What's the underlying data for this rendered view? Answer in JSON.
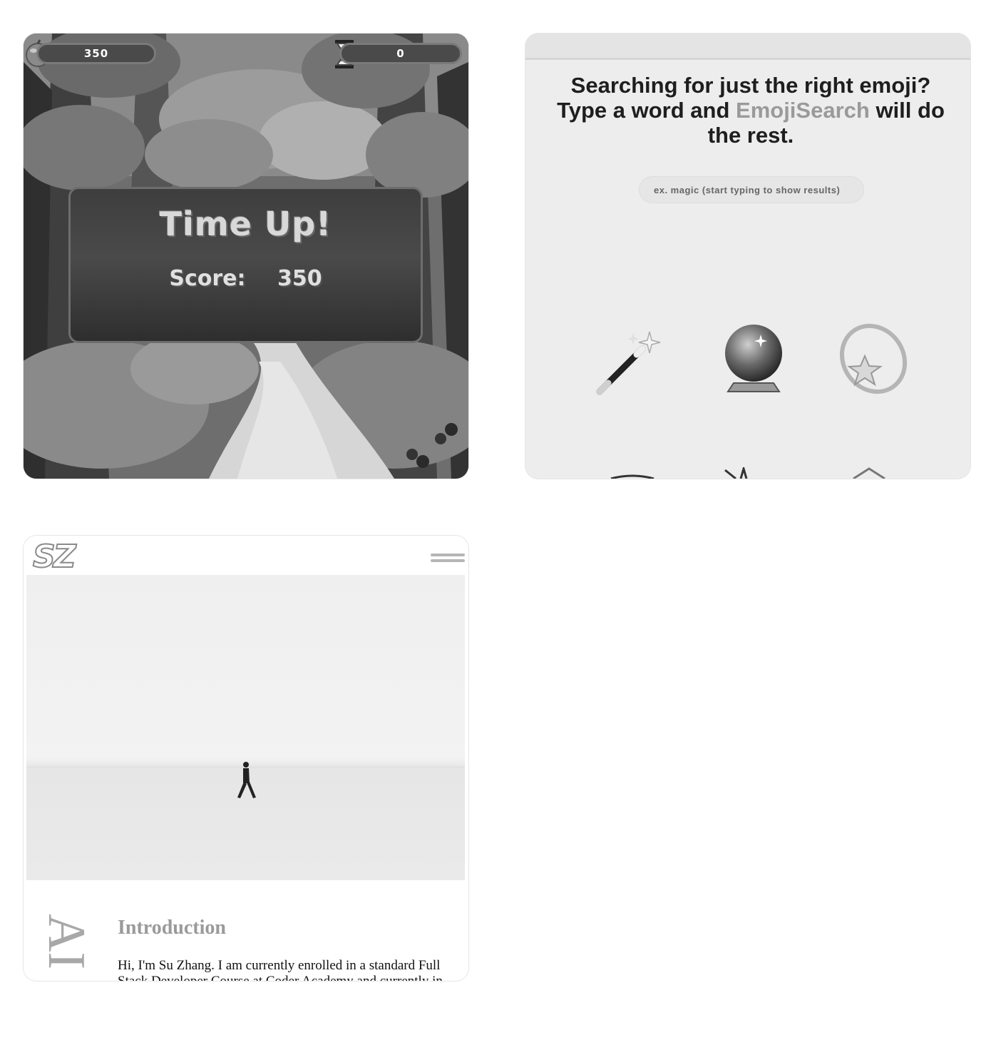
{
  "game": {
    "score_value": "350",
    "timer_value": "0",
    "panel_title": "Time Up!",
    "panel_score_label": "Score:",
    "panel_score_value": "350",
    "icons": [
      "fruit-icon",
      "hourglass-icon"
    ]
  },
  "emoji_search": {
    "heading_part1": "Searching for just the right emoji? Type a word and ",
    "heading_brand": "EmojiSearch",
    "heading_part2": " will do the rest.",
    "search_placeholder": "ex. magic (start typing to show results)",
    "results": [
      "magic-wand-icon",
      "crystal-ball-icon",
      "shooting-star-icon"
    ]
  },
  "portfolio": {
    "logo": "SZ",
    "side_letters": "AI",
    "intro_title": "Introduction",
    "intro_text": "Hi, I'm Su Zhang. I am currently enrolled in a standard Full Stack Developer Course at Coder Academy and currently in"
  },
  "colors": {
    "page_bg": "#ffffff",
    "emoji_card_bg": "#ededed",
    "brand_gray": "#9a9a9a"
  }
}
